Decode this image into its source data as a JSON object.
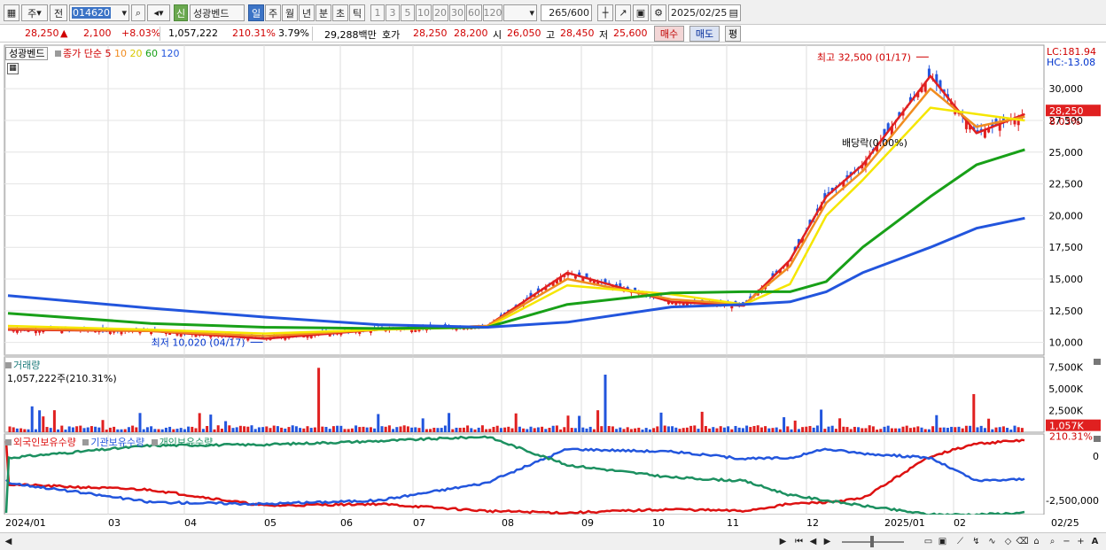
{
  "toolbar": {
    "market": "주",
    "prefix": "전",
    "code": "014620",
    "credit_badge": "신",
    "stock_name": "성광벤드",
    "periods": [
      "일",
      "주",
      "월",
      "년",
      "분",
      "초",
      "틱"
    ],
    "active_period": "일",
    "minutes": [
      "1",
      "3",
      "5",
      "10",
      "20",
      "30",
      "60",
      "120"
    ],
    "count": "265",
    "count_total": "/600",
    "date": "2025/02/25"
  },
  "quote": {
    "price": "28,250",
    "change": "2,100",
    "change_pct": "+8.03%",
    "volume": "1,057,222",
    "volume_ratio": "210.31%",
    "turnover": "3.79%",
    "amount": "29,288백만",
    "bid_label": "호가",
    "ask": "28,250",
    "bid": "28,200",
    "open_label": "시",
    "open": "26,050",
    "high_label": "고",
    "high": "28,450",
    "low_label": "저",
    "low": "25,600",
    "buy_button": "매수",
    "sell_button": "매도",
    "eval_button": "평"
  },
  "legends": {
    "price_name": "성광벤드",
    "ma_title": "종가 단순",
    "ma_periods": [
      "5",
      "10",
      "20",
      "60",
      "120"
    ],
    "volume_title": "거래량",
    "volume_info": "1,057,222주(210.31%)",
    "holdings": [
      "외국인보유수량",
      "기관보유수량",
      "개인보유수량"
    ]
  },
  "annotations": {
    "lc": "LC:181.94",
    "hc": "HC:-13.08",
    "max_label": "최고 32,500 (01/17)",
    "min_label": "최저 10,020 (04/17)",
    "dividend_label": "배당락(0.00%)",
    "last_price": "28,250",
    "last_pct": "8.03%",
    "last_volume": "1,057K",
    "last_volume_pct": "210.31%"
  },
  "axes": {
    "price_ticks": [
      "30,000",
      "27,500",
      "25,000",
      "22,500",
      "20,000",
      "17,500",
      "15,000",
      "12,500",
      "10,000"
    ],
    "volume_ticks": [
      "7,500K",
      "5,000K",
      "2,500K"
    ],
    "holding_ticks": [
      "0",
      "-2,500,000"
    ],
    "date_labels": [
      "2024/01",
      "03",
      "04",
      "05",
      "06",
      "07",
      "08",
      "09",
      "10",
      "11",
      "12",
      "2025/01",
      "02",
      "02/25"
    ]
  },
  "colors": {
    "ma5": "#e02020",
    "ma10": "#f08c20",
    "ma20": "#f5e600",
    "ma60": "#18a018",
    "ma120": "#2255dd",
    "up": "#e02020",
    "down": "#2255dd",
    "foreign": "#dd1111",
    "institution": "#2255dd",
    "individual": "#1c9060"
  },
  "chart_data": {
    "type": "line",
    "title": "성광벤드",
    "x": [
      "2024-01-02",
      "2024-03-01",
      "2024-04-17",
      "2024-06-03",
      "2024-07-18",
      "2024-08-20",
      "2024-10-02",
      "2024-11-01",
      "2024-11-20",
      "2024-12-05",
      "2024-12-20",
      "2025-01-17",
      "2025-02-05",
      "2025-02-25"
    ],
    "series": [
      {
        "name": "5",
        "values": [
          11000,
          10900,
          10300,
          11000,
          11300,
          15500,
          13200,
          12900,
          16500,
          21500,
          24000,
          31000,
          26500,
          28000
        ]
      },
      {
        "name": "10",
        "values": [
          11100,
          10900,
          10500,
          11000,
          11300,
          15000,
          13400,
          13000,
          16000,
          21000,
          23500,
          30000,
          27000,
          27800
        ]
      },
      {
        "name": "20",
        "values": [
          11300,
          11000,
          10700,
          11000,
          11200,
          14500,
          13800,
          13000,
          14600,
          20000,
          22800,
          28500,
          28000,
          27500
        ]
      },
      {
        "name": "60",
        "values": [
          12300,
          11500,
          11200,
          11100,
          11200,
          13000,
          13900,
          14000,
          14000,
          14800,
          17500,
          21500,
          24000,
          25200
        ]
      },
      {
        "name": "120",
        "values": [
          13700,
          12700,
          12000,
          11400,
          11200,
          11600,
          12800,
          13000,
          13200,
          14000,
          15500,
          17500,
          19000,
          19800
        ]
      }
    ],
    "ylim": [
      9000,
      33500
    ],
    "max": {
      "value": 32500,
      "date": "01/17"
    },
    "min": {
      "value": 10020,
      "date": "04/17"
    },
    "volume_ylim": [
      0,
      8800000
    ],
    "volume_last": 1057222,
    "holdings": {
      "ylim": [
        -3300000,
        1300000
      ],
      "series": [
        {
          "name": "외국인보유수량",
          "values": [
            -1600000,
            -1900000,
            -2800000,
            -2700000,
            -3100000,
            -3200000,
            -3000000,
            -3100000,
            -2700000,
            -2600000,
            -2400000,
            0,
            700000,
            900000
          ]
        },
        {
          "name": "기관보유수량",
          "values": [
            -1500000,
            -2600000,
            -2700000,
            -2500000,
            -1500000,
            400000,
            250000,
            -150000,
            -100000,
            400000,
            150000,
            -100000,
            -1400000,
            -1300000
          ]
        },
        {
          "name": "개인보유수량",
          "values": [
            -100000,
            600000,
            650000,
            850000,
            1100000,
            -500000,
            -1200000,
            -1400000,
            -2200000,
            -2500000,
            -2800000,
            -3300000,
            -3300000,
            -3200000
          ]
        }
      ]
    }
  }
}
